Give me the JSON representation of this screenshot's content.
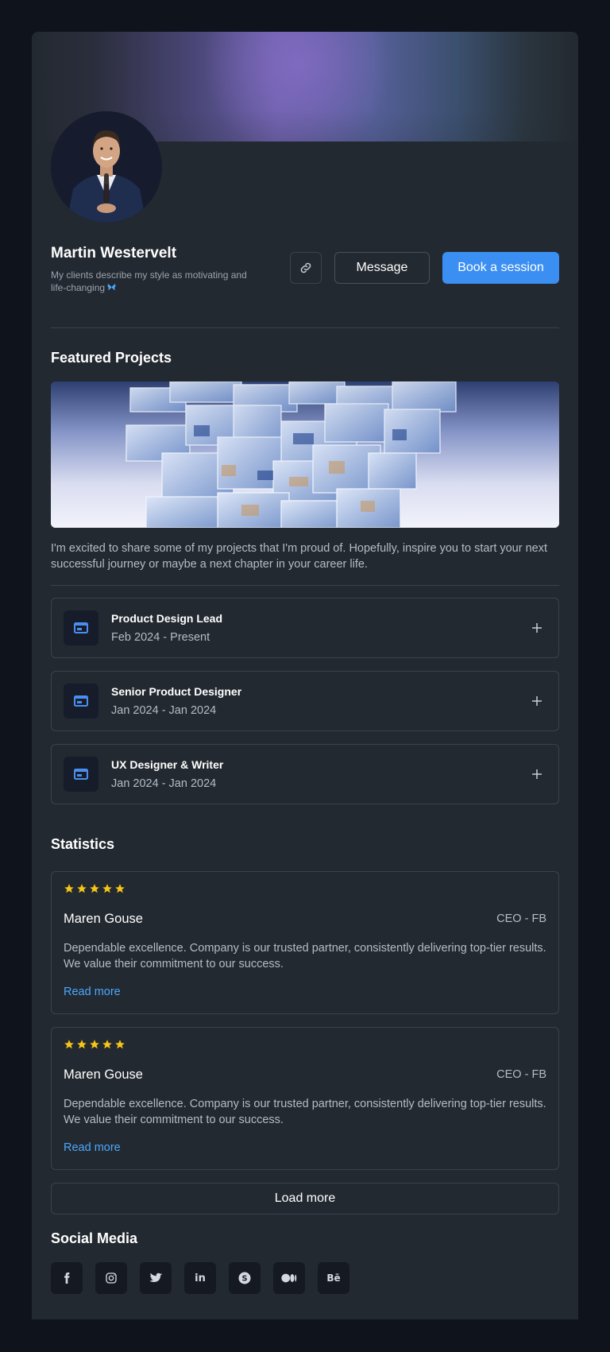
{
  "profile": {
    "name": "Martin Westervelt",
    "bio": "My clients describe my style as motivating and life-changing",
    "bio_icon": "butterfly-icon"
  },
  "actions": {
    "link_icon": "link-icon",
    "message_label": "Message",
    "book_label": "Book a session",
    "accent_color": "#3b8ff3"
  },
  "featured": {
    "title": "Featured Projects",
    "intro": "I'm excited to share some of my projects that I'm proud of. Hopefully, inspire you to start your next successful journey or maybe a next chapter in your career life."
  },
  "experience": [
    {
      "title": "Product Design Lead",
      "dates": "Feb 2024 - Present",
      "icon": "browser-window-icon"
    },
    {
      "title": "Senior Product Designer",
      "dates": "Jan 2024 - Jan 2024",
      "icon": "browser-window-icon"
    },
    {
      "title": "UX Designer & Writer",
      "dates": "Jan 2024 - Jan 2024",
      "icon": "browser-window-icon"
    }
  ],
  "statistics": {
    "title": "Statistics",
    "reviews": [
      {
        "rating": 5,
        "name": "Maren Gouse",
        "role": "CEO - FB",
        "text": "Dependable excellence. Company is our trusted partner, consistently delivering top-tier results. We value their commitment to our success.",
        "read_more": "Read more"
      },
      {
        "rating": 5,
        "name": "Maren Gouse",
        "role": "CEO - FB",
        "text": "Dependable excellence. Company is our trusted partner, consistently delivering top-tier results. We value their commitment to our success.",
        "read_more": "Read more"
      }
    ],
    "load_more": "Load more"
  },
  "social": {
    "title": "Social Media",
    "items": [
      {
        "name": "facebook-icon",
        "glyph": "f"
      },
      {
        "name": "instagram-icon",
        "glyph": ""
      },
      {
        "name": "twitter-icon",
        "glyph": ""
      },
      {
        "name": "linkedin-icon",
        "glyph": "in"
      },
      {
        "name": "skype-icon",
        "glyph": "S"
      },
      {
        "name": "medium-icon",
        "glyph": ""
      },
      {
        "name": "behance-icon",
        "glyph": "Bē"
      }
    ]
  }
}
